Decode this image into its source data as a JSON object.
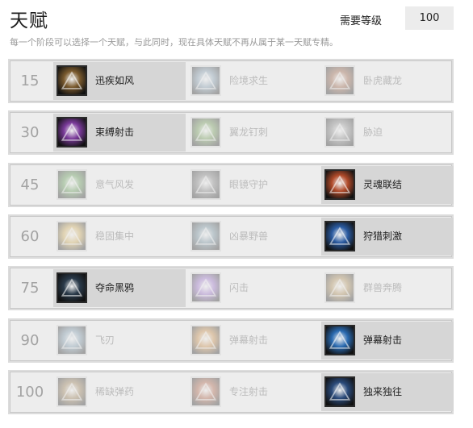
{
  "header": {
    "title": "天赋",
    "level_label": "需要等级",
    "level_value": "100",
    "subtitle": "每一个阶段可以选择一个天赋，与此同时，现在具体天赋不再从属于某一天赋专精。"
  },
  "tiers": [
    {
      "level": "15",
      "talents": [
        {
          "name": "迅疾如风",
          "icon": "boot-icon",
          "color": "#7a5a2e",
          "selected": true
        },
        {
          "name": "险境求生",
          "icon": "claw-icon",
          "color": "#6d8aa0",
          "selected": false
        },
        {
          "name": "卧虎藏龙",
          "icon": "beast-icon",
          "color": "#8a4a2a",
          "selected": false
        }
      ]
    },
    {
      "level": "30",
      "talents": [
        {
          "name": "束缚射击",
          "icon": "binding-shot-icon",
          "color": "#7a3a9a",
          "selected": true
        },
        {
          "name": "翼龙钉刺",
          "icon": "wyvern-sting-icon",
          "color": "#5a8a3a",
          "selected": false
        },
        {
          "name": "胁迫",
          "icon": "intimidation-icon",
          "color": "#777777",
          "selected": false
        }
      ]
    },
    {
      "level": "45",
      "talents": [
        {
          "name": "意气风发",
          "icon": "exhilaration-icon",
          "color": "#4a8a3a",
          "selected": false
        },
        {
          "name": "眼镜守护",
          "icon": "aspect-icon",
          "color": "#6a6a6a",
          "selected": false
        },
        {
          "name": "灵魂联结",
          "icon": "spirit-bond-icon",
          "color": "#b04a2a",
          "selected": true
        }
      ]
    },
    {
      "level": "60",
      "talents": [
        {
          "name": "稳固集中",
          "icon": "focus-icon",
          "color": "#c8a040",
          "selected": false
        },
        {
          "name": "凶暴野兽",
          "icon": "wild-beast-icon",
          "color": "#5a7a8a",
          "selected": false
        },
        {
          "name": "狩猎刺激",
          "icon": "thrill-of-hunt-icon",
          "color": "#2a5aa0",
          "selected": true
        }
      ]
    },
    {
      "level": "75",
      "talents": [
        {
          "name": "夺命黑鸦",
          "icon": "raven-icon",
          "color": "#2a3a4a",
          "selected": true
        },
        {
          "name": "闪击",
          "icon": "blink-strike-icon",
          "color": "#8a5ac0",
          "selected": false
        },
        {
          "name": "群兽奔腾",
          "icon": "stampede-icon",
          "color": "#a07a3a",
          "selected": false
        }
      ]
    },
    {
      "level": "90",
      "talents": [
        {
          "name": "飞刃",
          "icon": "glaive-icon",
          "color": "#6a8aa0",
          "selected": false
        },
        {
          "name": "弹幕射击",
          "icon": "powershot-icon",
          "color": "#c07a2a",
          "selected": false
        },
        {
          "name": "弹幕射击",
          "icon": "barrage-icon",
          "color": "#2a6ab0",
          "selected": true
        }
      ]
    },
    {
      "level": "100",
      "talents": [
        {
          "name": "稀缺弹药",
          "icon": "ammo-icon",
          "color": "#8a6a3a",
          "selected": false
        },
        {
          "name": "专注射击",
          "icon": "focusing-shot-icon",
          "color": "#a04a2a",
          "selected": false
        },
        {
          "name": "独来独往",
          "icon": "lone-wolf-icon",
          "color": "#2a4a7a",
          "selected": true
        }
      ]
    }
  ]
}
